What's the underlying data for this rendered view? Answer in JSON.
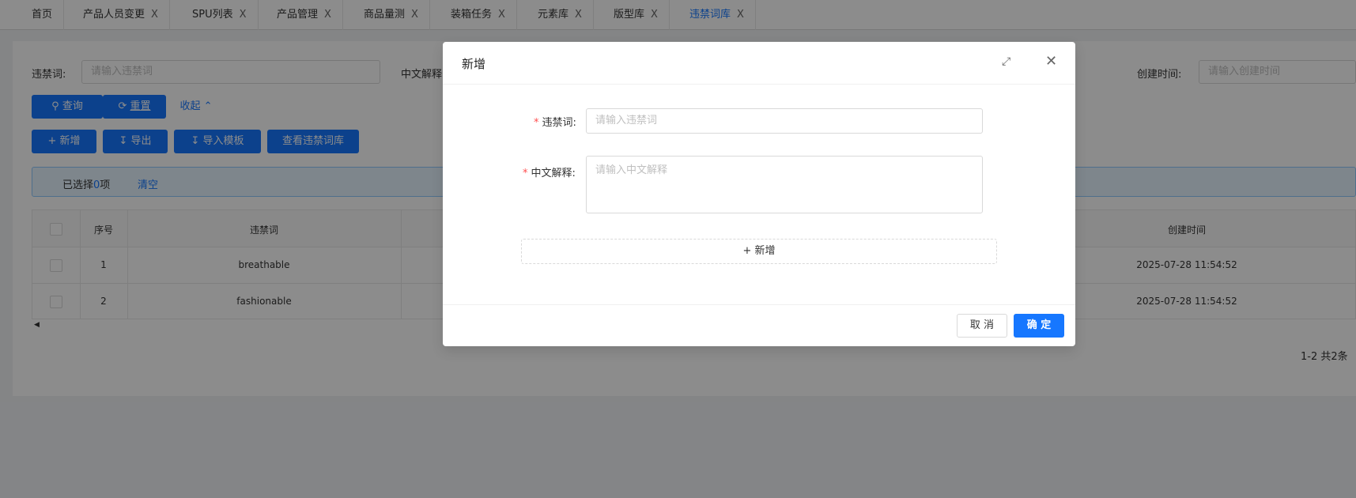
{
  "tabs": [
    {
      "label": "首页",
      "closable": false
    },
    {
      "label": "产品人员变更",
      "closable": true
    },
    {
      "label": "SPU列表",
      "closable": true
    },
    {
      "label": "产品管理",
      "closable": true
    },
    {
      "label": "商品量测",
      "closable": true
    },
    {
      "label": "装箱任务",
      "closable": true
    },
    {
      "label": "元素库",
      "closable": true
    },
    {
      "label": "版型库",
      "closable": true
    },
    {
      "label": "违禁词库",
      "closable": true,
      "active": true
    }
  ],
  "close_glyph": "X",
  "search": {
    "word_label": "违禁词:",
    "word_placeholder": "请输入违禁词",
    "cn_label": "中文解释",
    "time_label": "创建时间:",
    "time_placeholder": "请输入创建时间"
  },
  "toolbar": {
    "query": "查询",
    "reset": "重置",
    "collapse": "收起",
    "add": "新增",
    "export": "导出",
    "import_template": "导入模板",
    "view_library": "查看违禁词库"
  },
  "selection": {
    "prefix": "已选择",
    "count": "0",
    "suffix": "项",
    "clear": "清空"
  },
  "table": {
    "columns": [
      "序号",
      "违禁词",
      "创建时间"
    ],
    "rows": [
      {
        "index": "1",
        "word": "breathable",
        "created": "2025-07-28 11:54:52"
      },
      {
        "index": "2",
        "word": "fashionable",
        "created": "2025-07-28 11:54:52"
      }
    ]
  },
  "pagination": {
    "summary": "1-2 共2条"
  },
  "modal": {
    "title": "新增",
    "word_label": "违禁词:",
    "word_placeholder": "请输入违禁词",
    "cn_label": "中文解释:",
    "cn_placeholder": "请输入中文解释",
    "add_row": "新增",
    "cancel": "取 消",
    "ok": "确 定"
  },
  "colors": {
    "primary": "#1677ff",
    "required": "#ff4d4f",
    "overlay": "rgba(0,0,0,0.45)"
  }
}
